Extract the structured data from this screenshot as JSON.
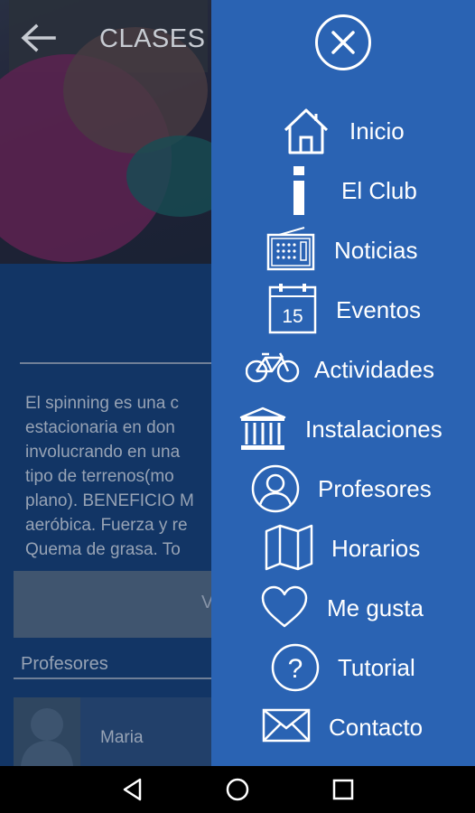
{
  "app": {
    "title": "CLASES",
    "description": "El spinning es una c\nestacionaria en don\ninvolucrando en una\ntipo de terrenos(mo\nplano). BENEFICIO M\naeróbica. Fuerza y re\nQuema de grasa. To",
    "button_label": "Ve",
    "teachers_header": "Profesores",
    "teacher_name": "Maria"
  },
  "drawer": {
    "items": [
      {
        "label": "Inicio",
        "icon": "home-icon"
      },
      {
        "label": "El Club",
        "icon": "info-icon"
      },
      {
        "label": "Noticias",
        "icon": "radio-icon"
      },
      {
        "label": "Eventos",
        "icon": "calendar-icon",
        "icon_text": "15"
      },
      {
        "label": "Actividades",
        "icon": "bicycle-icon"
      },
      {
        "label": "Instalaciones",
        "icon": "building-icon"
      },
      {
        "label": "Profesores",
        "icon": "person-icon"
      },
      {
        "label": "Horarios",
        "icon": "map-icon"
      },
      {
        "label": "Me gusta",
        "icon": "heart-icon"
      },
      {
        "label": "Tutorial",
        "icon": "help-icon",
        "icon_text": "?"
      },
      {
        "label": "Contacto",
        "icon": "mail-icon"
      }
    ]
  },
  "colors": {
    "drawer_bg": "#2a63b3",
    "app_bg": "#123565",
    "nav_bg": "#000000"
  }
}
